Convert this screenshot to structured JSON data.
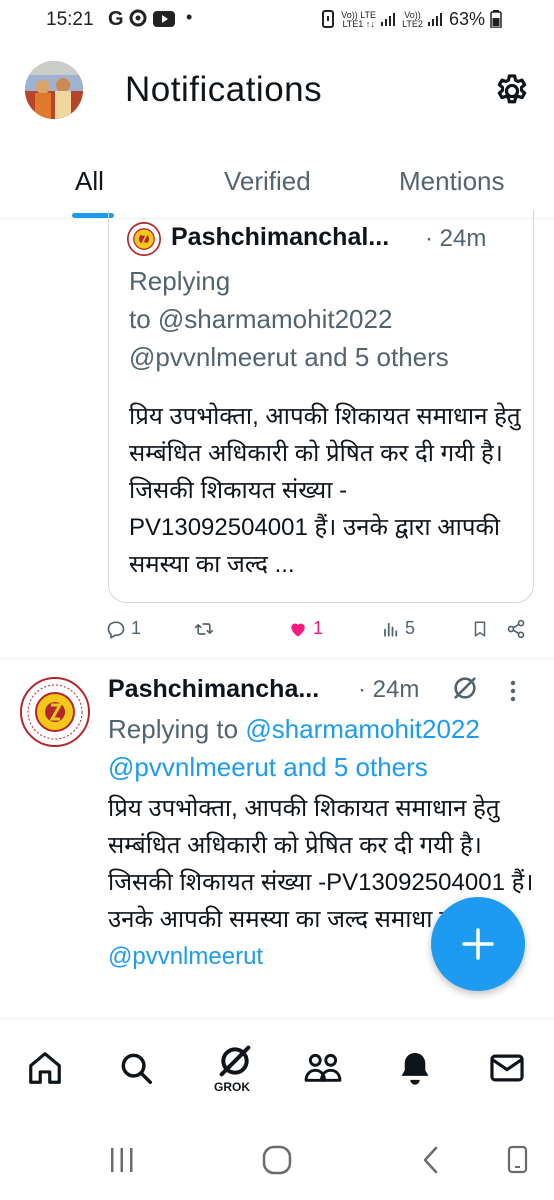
{
  "status_bar": {
    "time": "15:21",
    "app_icons": "G",
    "dot": "•",
    "signal_label_1": "Vo)) LTE",
    "signal_label_2": "LTE1 ↑↓",
    "signal_label_3": "Vo))",
    "signal_label_4": "LTE2",
    "battery": "63%"
  },
  "header": {
    "title": "Notifications"
  },
  "tabs": [
    {
      "label": "All",
      "active": true
    },
    {
      "label": "Verified",
      "active": false
    },
    {
      "label": "Mentions",
      "active": false
    }
  ],
  "quoted_tweet": {
    "name": "Pashchimanchal...",
    "time": "· 24m",
    "replying_line1": "Replying",
    "replying_line2": "to @sharmamohit2022",
    "replying_line3": "@pvvnlmeerut and 5 others",
    "text": "प्रिय उपभोक्ता, आपकी शिकायत समाधान हेतु सम्बंधित अधिकारी को प्रेषित कर दी गयी है। जिसकी शिकायत संख्या -PV13092504001 हैं। उनके द्वारा आपकी समस्या का जल्द ..."
  },
  "actions": {
    "replies": "1",
    "likes": "1",
    "views": "5",
    "like_color": "#f91880"
  },
  "tweet": {
    "name": "Pashchimancha...",
    "time": "· 24m",
    "replying_prefix": "Replying to ",
    "replying_handle": "@sharmamohit2022",
    "replying_others": "@pvvnlmeerut and 5 others",
    "text": "प्रिय उपभोक्ता, आपकी शिकायत समाधान हेतु सम्बंधित अधिकारी को  प्रेषित कर दी गयी है। जिसकी शिकायत संख्या -PV13092504001 हैं। उनके आपकी समस्या का जल्द  समाधा जायेगा । ",
    "mention": "@pvvnlmeerut"
  },
  "bottom_nav": {
    "grok_label": "GROK",
    "items": [
      "home-icon",
      "search-icon",
      "grok-icon",
      "communities-icon",
      "notifications-icon",
      "messages-icon"
    ]
  },
  "colors": {
    "accent": "#1d9bf0",
    "text": "#0f1419",
    "muted": "#536471"
  }
}
